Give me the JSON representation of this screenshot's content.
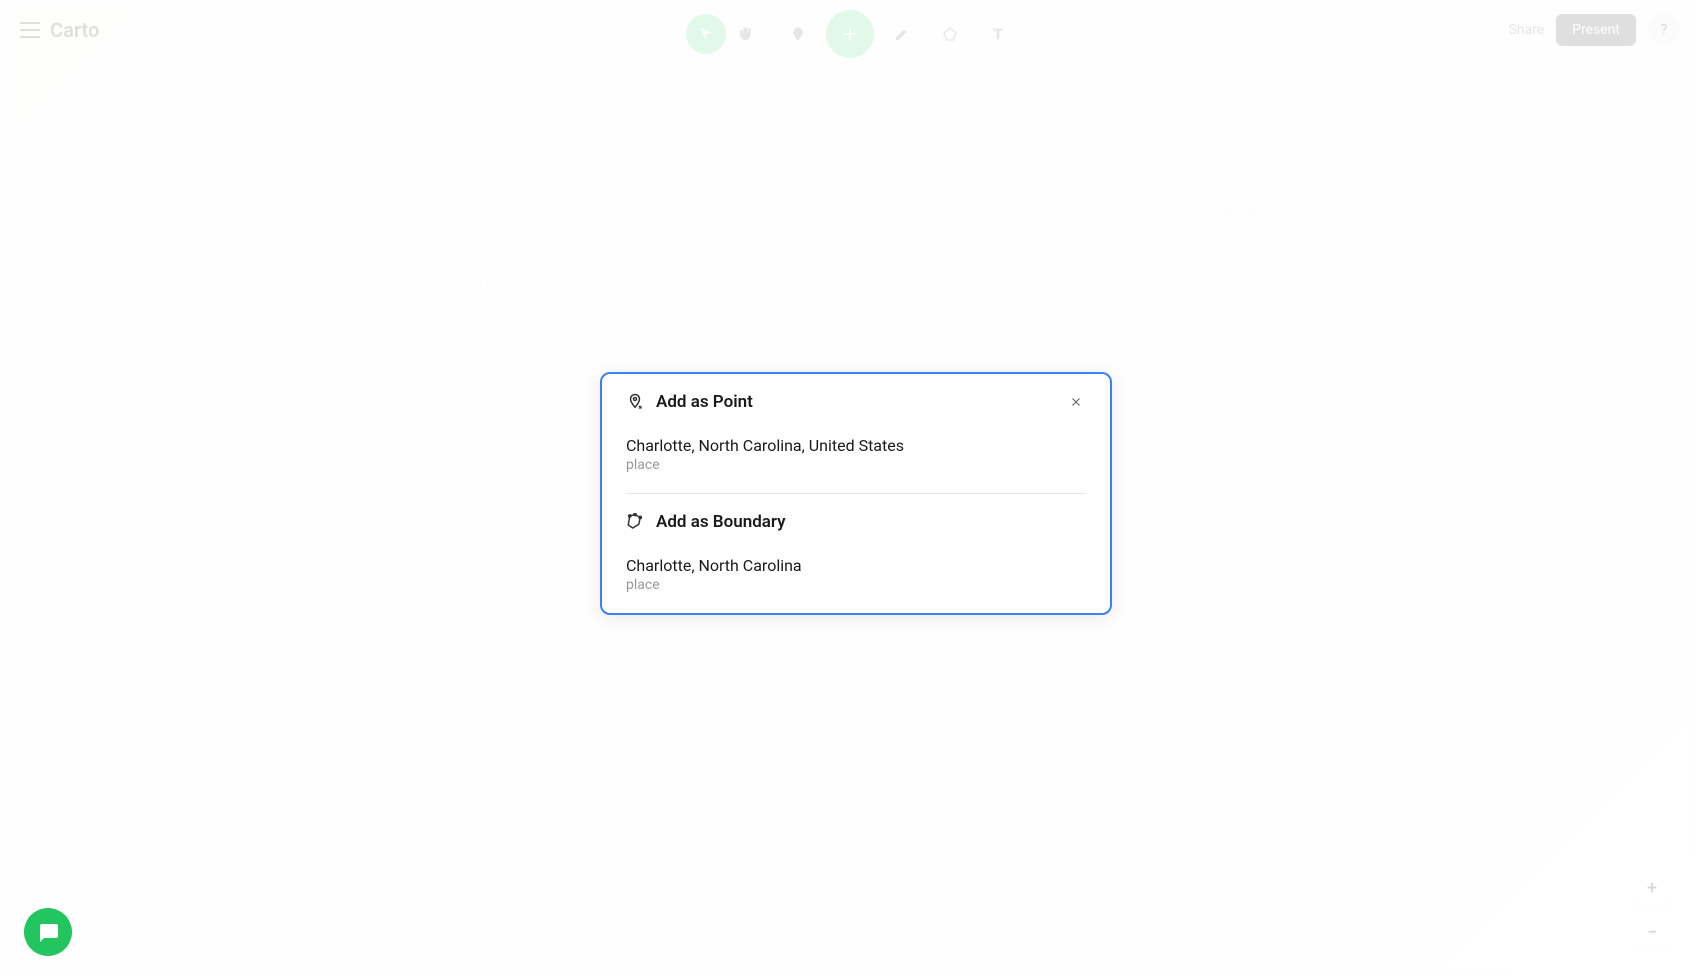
{
  "app": {
    "logo": "Carto"
  },
  "topBar": {
    "shareLabel": "Share",
    "presentLabel": "Present",
    "helpLabel": "?"
  },
  "dialog": {
    "pointSection": {
      "title": "Add as Point",
      "option": {
        "name": "Charlotte, North Carolina, United States",
        "type": "place"
      }
    },
    "boundarySection": {
      "title": "Add as Boundary",
      "option": {
        "name": "Charlotte, North Carolina",
        "type": "place"
      }
    }
  },
  "mapLabels": {
    "gastonia": "Gastonia",
    "mountHolly": "Mount Holly",
    "concord": "Concord",
    "kannapolis": "Kannapolis",
    "huntersville": "Huntersville",
    "matthews": "Matthews",
    "mintHill": "Mint Hill",
    "pineville": "Pineville"
  },
  "zoomControls": {
    "plus": "+",
    "minus": "−"
  }
}
